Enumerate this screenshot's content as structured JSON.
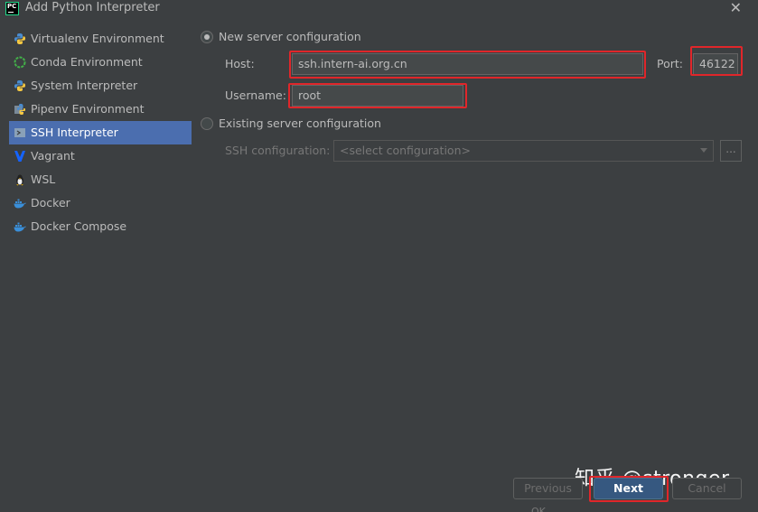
{
  "window": {
    "title": "Add Python Interpreter",
    "app_icon_text": "PC"
  },
  "sidebar": {
    "items": [
      {
        "label": "Virtualenv Environment",
        "icon": "python-icon",
        "active": false
      },
      {
        "label": "Conda Environment",
        "icon": "conda-icon",
        "active": false
      },
      {
        "label": "System Interpreter",
        "icon": "python-icon",
        "active": false
      },
      {
        "label": "Pipenv Environment",
        "icon": "pipenv-icon",
        "active": false
      },
      {
        "label": "SSH Interpreter",
        "icon": "ssh-terminal-icon",
        "active": true
      },
      {
        "label": "Vagrant",
        "icon": "vagrant-icon",
        "active": false
      },
      {
        "label": "WSL",
        "icon": "linux-penguin-icon",
        "active": false
      },
      {
        "label": "Docker",
        "icon": "docker-icon",
        "active": false
      },
      {
        "label": "Docker Compose",
        "icon": "docker-icon",
        "active": false
      }
    ]
  },
  "new_server": {
    "label": "New server configuration",
    "selected": true,
    "host_label": "Host:",
    "host_value": "ssh.intern-ai.org.cn",
    "port_label": "Port:",
    "port_value": "46122",
    "username_label": "Username:",
    "username_value": "root"
  },
  "existing_server": {
    "label": "Existing server configuration",
    "selected": false,
    "ssh_config_label": "SSH configuration:",
    "ssh_config_placeholder": "<select configuration>",
    "browse_label": "..."
  },
  "footer": {
    "previous_label": "Previous",
    "next_label": "Next",
    "cancel_label": "Cancel",
    "ok_partial": "OK"
  },
  "watermark": "知乎 @stronger",
  "colors": {
    "background": "#3c3f41",
    "selection": "#4b6eaf",
    "field_bg": "#45494a",
    "primary_button": "#365880",
    "highlight_red": "#e0262a"
  }
}
